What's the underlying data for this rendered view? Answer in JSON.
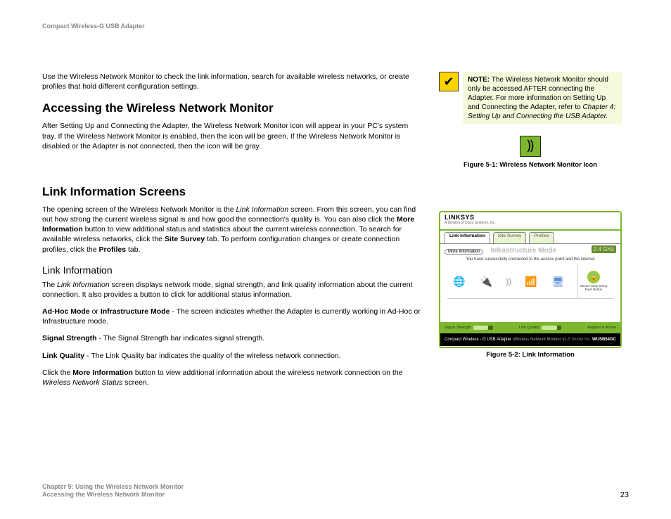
{
  "header": {
    "product": "Compact Wireless-G USB Adapter"
  },
  "main": {
    "intro": "Use the Wireless Network Monitor to check the link information, search for available wireless networks, or create profiles that hold different configuration settings.",
    "h2a": "Accessing the Wireless Network Monitor",
    "p_access": "After Setting Up and Connecting the Adapter, the Wireless Network Monitor icon will appear in your PC's system tray. If the Wireless Network Monitor is enabled, then the icon will be green. If the Wireless Network Monitor is disabled or the Adapter is not connected, then the icon will be gray.",
    "h2b": "Link Information Screens",
    "p_link1a": "The opening screen of the Wireless Network Monitor is the ",
    "p_link1_em": "Link Information",
    "p_link1b": " screen. From this screen, you can find out how strong the current wireless signal is and how good the connection's quality is. You can also click the ",
    "p_link1_b1": "More Information",
    "p_link1c": " button to view additional status and statistics about the current wireless connection. To search for available wireless networks, click the ",
    "p_link1_b2": "Site Survey",
    "p_link1d": " tab. To perform configuration changes or create connection profiles, click the ",
    "p_link1_b3": "Profiles",
    "p_link1e": " tab.",
    "h3": "Link Information",
    "p_li2a": "The ",
    "p_li2_em": "Link Information",
    "p_li2b": " screen displays network mode, signal strength, and link quality information about the current connection. It also provides a button to click for additional status information.",
    "p_mode_b": "Ad-Hoc Mode",
    "p_mode_or": " or ",
    "p_mode_b2": "Infrastructure Mode",
    "p_mode_rest": " - The screen indicates whether the Adapter is currently working in Ad-Hoc or Infrastructure mode.",
    "p_ss_b": "Signal Strength",
    "p_ss_rest": " - The Signal Strength bar indicates signal strength.",
    "p_lq_b": "Link Quality",
    "p_lq_rest": " - The Link Quality bar indicates the quality of the wireless network connection.",
    "p_click_a": "Click the ",
    "p_click_b": "More Information",
    "p_click_c": " button to view additional information about the wireless network connection on the ",
    "p_click_em": "Wireless Network Status",
    "p_click_d": " screen."
  },
  "note": {
    "label": "NOTE:",
    "text1": " The Wireless Network Monitor should only be accessed AFTER connecting the Adapter. For more information on Setting Up and Connecting the Adapter, refer to ",
    "italic": "Chapter 4: Setting Up and Connecting the USB Adapter."
  },
  "figures": {
    "cap1": "Figure 5-1: Wireless Network Monitor Icon",
    "cap2": "Figure 5-2: Link Information"
  },
  "screenshot": {
    "logo": "LINKSYS",
    "sublogo": "A Division of Cisco Systems, Inc.",
    "tab1": "Link Information",
    "tab2": "Site Survey",
    "tab3": "Profiles",
    "moreinfo": "More Information",
    "mode": "Infrastructure Mode",
    "ghz": "2.4 GHz",
    "msg": "You have successfully connected to the access point and the internet",
    "lock_text": "Secure Easy Setup Push Button",
    "bar1": "Signal Strength",
    "bar2": "Link Quality",
    "bar3": "Adapter is Active",
    "bottom_prod": "Compact Wireless - G USB Adapter",
    "bottom_mid": "Wireless Network Monitor v1.0",
    "bottom_model": "WUSB54GC"
  },
  "footer": {
    "line1": "Chapter 5: Using the Wireless Network Monitor",
    "line2": "Accessing the Wireless Network Monitor",
    "page": "23"
  }
}
